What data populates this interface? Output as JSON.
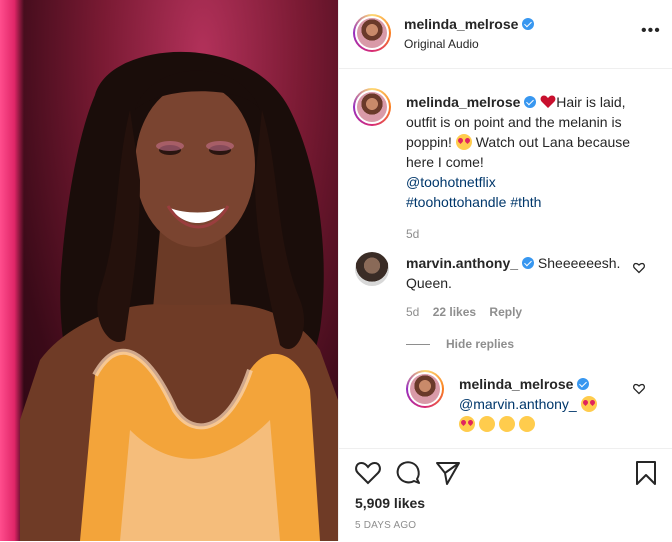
{
  "header": {
    "username": "melinda_melrose",
    "audio": "Original Audio",
    "more": "•••"
  },
  "caption": {
    "username": "melinda_melrose",
    "line1": "Hair is laid,",
    "line2": "outfit is on point and the melanin is",
    "line3a": "poppin!",
    "line3b": "Watch out Lana because",
    "line4": "here I come!",
    "mention": "@toohotnetflix",
    "hashtags": "#toohottohandle #thth",
    "time": "5d"
  },
  "comments": [
    {
      "username": "marvin.anthony_",
      "text1": "Sheeeeeesh.",
      "text2": "Queen.",
      "time": "5d",
      "likes": "22 likes",
      "reply": "Reply"
    }
  ],
  "replies": {
    "toggle": "Hide replies",
    "items": [
      {
        "username": "melinda_melrose",
        "mention": "@marvin.anthony_"
      }
    ]
  },
  "footer": {
    "likes": "5,909 likes",
    "date": "5 DAYS AGO"
  },
  "colors": {
    "verified": "#3897f0",
    "link": "#00376b",
    "muted": "#8e8e8e"
  },
  "icons": [
    "heart-icon",
    "comment-icon",
    "share-icon",
    "bookmark-icon",
    "more-icon",
    "verified-icon"
  ]
}
